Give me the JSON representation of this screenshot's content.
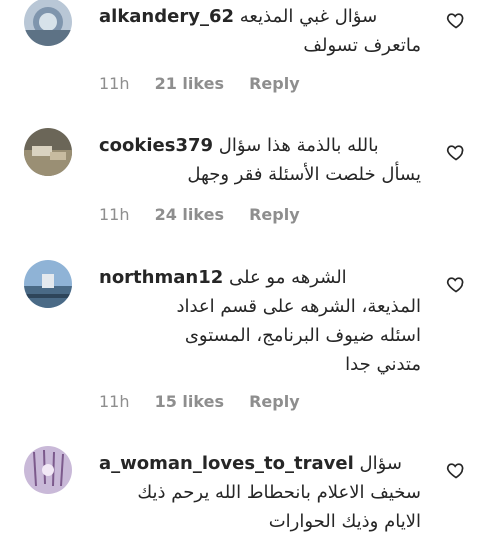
{
  "comments": [
    {
      "username": "alkandery_62",
      "text_line1": "سؤال غبي المذيعه",
      "text_rest": "ماتعرف تسولف",
      "time": "11h",
      "likes": "21 likes",
      "reply": "Reply"
    },
    {
      "username": "cookies379",
      "text_line1": "بالله بالذمة هذا سؤال",
      "text_rest": "يسأل خلصت الأسئلة فقر وجهل",
      "time": "11h",
      "likes": "24 likes",
      "reply": "Reply"
    },
    {
      "username": "northman12",
      "text_line1": "الشرهه مو على",
      "text_rest": "المذيعة، الشرهه على قسم اعداد\nاسئله ضيوف البرنامج، المستوى\nمتدني جدا",
      "time": "11h",
      "likes": "15 likes",
      "reply": "Reply"
    },
    {
      "username": "a_woman_loves_to_travel",
      "text_line1": "سؤال",
      "text_rest": "سخيف الاعلام بانحطاط الله يرحم ذيك\nالايام وذيك الحوارات",
      "time": "",
      "likes": "",
      "reply": ""
    }
  ],
  "icons": {
    "like": "heart-outline-icon"
  },
  "colors": {
    "text": "#262626",
    "meta": "#8e8e8e"
  }
}
